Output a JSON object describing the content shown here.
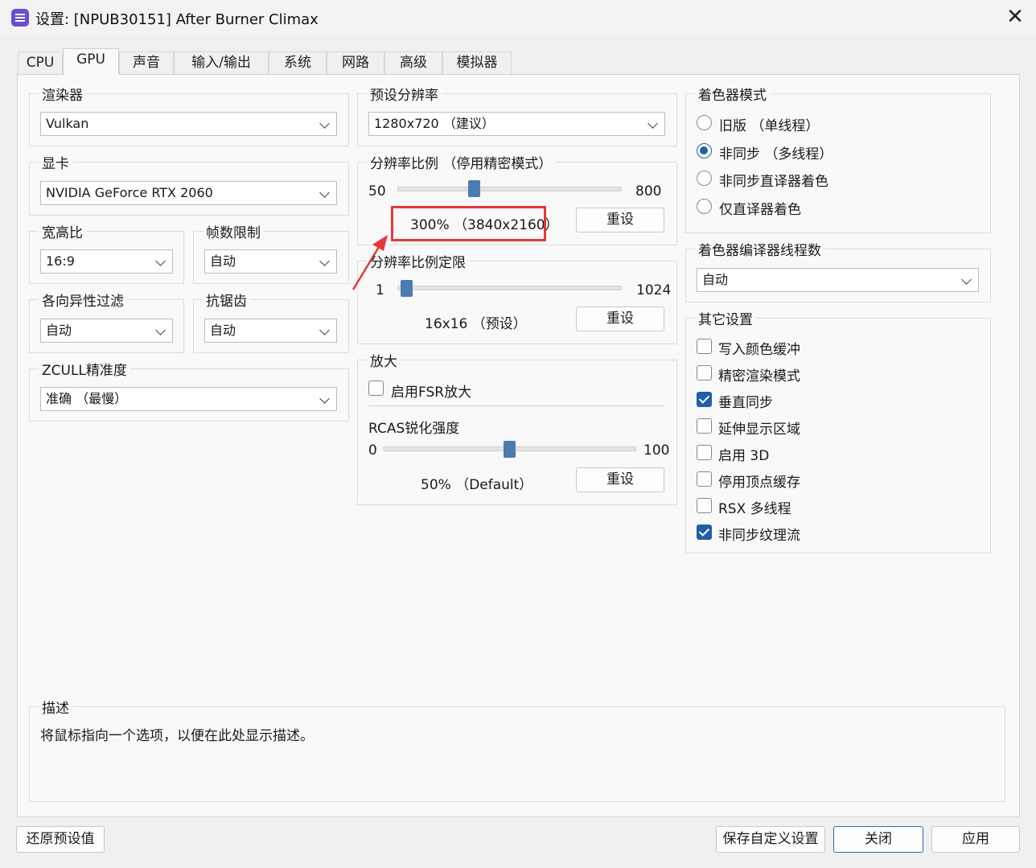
{
  "window": {
    "title": "设置: [NPUB30151] After Burner Climax"
  },
  "tabs": [
    {
      "label": "CPU"
    },
    {
      "label": "GPU"
    },
    {
      "label": "声音"
    },
    {
      "label": "输入/输出"
    },
    {
      "label": "系统"
    },
    {
      "label": "网路"
    },
    {
      "label": "高级"
    },
    {
      "label": "模拟器"
    }
  ],
  "renderer": {
    "label": "渲染器",
    "value": "Vulkan"
  },
  "gpu": {
    "label": "显卡",
    "value": "NVIDIA GeForce RTX 2060"
  },
  "aspect": {
    "label": "宽高比",
    "value": "16:9"
  },
  "framelimit": {
    "label": "帧数限制",
    "value": "自动"
  },
  "anisotropic": {
    "label": "各向异性过滤",
    "value": "自动"
  },
  "antialias": {
    "label": "抗锯齿",
    "value": "自动"
  },
  "zcull": {
    "label": "ZCULL精准度",
    "value": "准确 （最慢）"
  },
  "default_resolution": {
    "label": "预设分辨率",
    "value": "1280x720 （建议）"
  },
  "resolution_scale": {
    "label": "分辨率比例 （停用精密模式）",
    "min": "50",
    "max": "800",
    "value_text": "300% （3840x2160）",
    "value": 300,
    "reset": "重设"
  },
  "scale_threshold": {
    "label": "分辨率比例定限",
    "min": "1",
    "max": "1024",
    "value_text": "16x16 （预设）",
    "value": 16,
    "reset": "重设"
  },
  "upscale": {
    "label": "放大",
    "fsr_label": "启用FSR放大",
    "fsr_checked": false,
    "rcas_label": "RCAS锐化强度",
    "rcas_min": "0",
    "rcas_max": "100",
    "rcas_value_text": "50% （Default）",
    "rcas_value": 50,
    "reset": "重设"
  },
  "shader_mode": {
    "label": "着色器模式",
    "options": [
      {
        "label": "旧版 （单线程）",
        "selected": false
      },
      {
        "label": "非同步 （多线程）",
        "selected": true
      },
      {
        "label": "非同步直译器着色",
        "selected": false
      },
      {
        "label": "仅直译器着色",
        "selected": false
      }
    ]
  },
  "shader_threads": {
    "label": "着色器编译器线程数",
    "value": "自动"
  },
  "other": {
    "label": "其它设置",
    "items": [
      {
        "label": "写入颜色缓冲",
        "checked": false
      },
      {
        "label": "精密渲染模式",
        "checked": false
      },
      {
        "label": "垂直同步",
        "checked": true
      },
      {
        "label": "延伸显示区域",
        "checked": false
      },
      {
        "label": "启用 3D",
        "checked": false
      },
      {
        "label": "停用顶点缓存",
        "checked": false
      },
      {
        "label": "RSX 多线程",
        "checked": false
      },
      {
        "label": "非同步纹理流",
        "checked": true
      }
    ]
  },
  "description": {
    "label": "描述",
    "text": "将鼠标指向一个选项，以便在此处显示描述。"
  },
  "footer": {
    "restore": "还原预设值",
    "save_custom": "保存自定义设置",
    "close": "关闭",
    "apply": "应用"
  },
  "colors": {
    "accent": "#1f5fa8",
    "highlight": "#e53935",
    "app_icon": "#6a4fd0"
  }
}
